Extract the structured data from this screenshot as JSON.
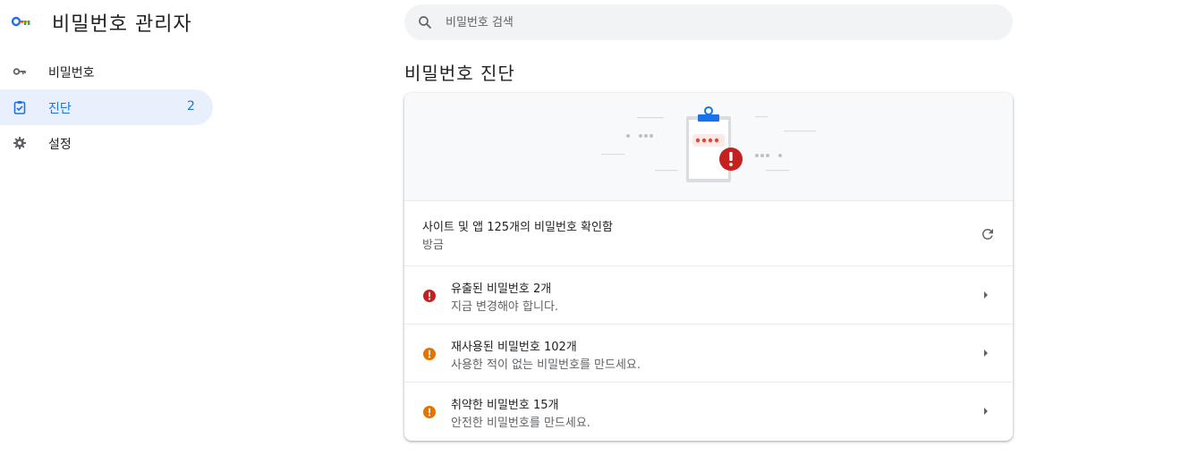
{
  "app": {
    "title": "비밀번호 관리자",
    "logo_icon": "key-icon",
    "colors": {
      "accent": "#1a73e8",
      "active_bg": "#e8f0fe",
      "danger": "#c5221f",
      "warning": "#e37400"
    }
  },
  "search": {
    "placeholder": "비밀번호 검색",
    "value": ""
  },
  "sidebar": {
    "items": [
      {
        "label": "비밀번호",
        "icon": "key-icon",
        "count": ""
      },
      {
        "label": "진단",
        "icon": "clipboard-check-icon",
        "count": "2",
        "active": true
      },
      {
        "label": "설정",
        "icon": "gear-icon",
        "count": ""
      }
    ]
  },
  "main": {
    "section_title": "비밀번호 진단",
    "summary": {
      "checked_text": "사이트 및 앱 125개의 비밀번호 확인함",
      "time_text": "방금",
      "refresh_icon": "refresh-icon"
    },
    "issues": [
      {
        "title": "유출된 비밀번호 2개",
        "description": "지금 변경해야 합니다.",
        "severity": "danger"
      },
      {
        "title": "재사용된 비밀번호 102개",
        "description": "사용한 적이 없는 비밀번호를 만드세요.",
        "severity": "warning"
      },
      {
        "title": "취약한 비밀번호 15개",
        "description": "안전한 비밀번호를 만드세요.",
        "severity": "warning"
      }
    ]
  }
}
